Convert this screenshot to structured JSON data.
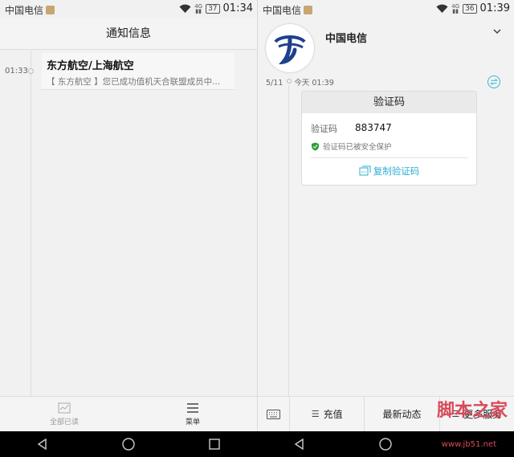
{
  "left": {
    "status": {
      "carrier": "中国电信",
      "battery": "37",
      "time": "01:34"
    },
    "title": "通知信息",
    "message": {
      "time": "01:33",
      "sender": "东方航空/上海航空",
      "snippet": "【 东方航空 】您已成功值机天合联盟成员中..."
    },
    "bottom": {
      "mark_all_read": "全部已读",
      "menu": "菜单"
    }
  },
  "right": {
    "status": {
      "carrier": "中国电信",
      "battery": "36",
      "time": "01:39"
    },
    "sender": "中国电信",
    "date": "5/11",
    "timestamp": "今天 01:39",
    "card": {
      "title": "验证码",
      "code_label": "验证码",
      "code": "883747",
      "safe_note": "验证码已被安全保护",
      "copy_label": "复制验证码"
    },
    "menu": {
      "recharge": "充值",
      "news": "最新动态",
      "more": "更多服务"
    }
  },
  "watermark": {
    "text": "脚本之家",
    "url": "www.jb51.net"
  },
  "colors": {
    "accent": "#2aaed3",
    "brand_blue": "#1f3f8f",
    "shield": "#2e9e3c"
  }
}
